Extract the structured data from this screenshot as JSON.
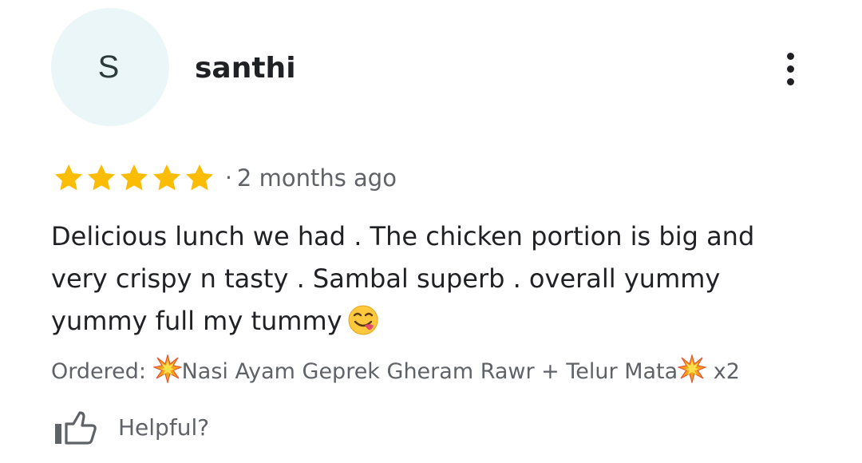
{
  "reviewer": {
    "avatar_letter": "S",
    "name": "santhi"
  },
  "colors": {
    "star": "#fbbc04",
    "avatar_bg": "#eaf6f7",
    "secondary_text": "#5f6368",
    "primary_text": "#202124"
  },
  "rating": {
    "stars": 5,
    "max": 5,
    "separator": "·",
    "time_ago": "2 months ago"
  },
  "review": {
    "line1": "Delicious lunch we had . The chicken portion is big and",
    "line2": "very crispy n tasty . Sambal superb . overall yummy",
    "line3": "yummy full my tummy",
    "emoji": "face-savoring-food-icon"
  },
  "ordered": {
    "label": "Ordered:",
    "item": "Nasi Ayam Geprek Gheram Rawr + Telur Mata",
    "quantity": "x2",
    "emoji": "collision-icon"
  },
  "actions": {
    "helpful_label": "Helpful?",
    "more_icon": "more-vertical-icon",
    "helpful_icon": "thumbs-up-icon"
  }
}
